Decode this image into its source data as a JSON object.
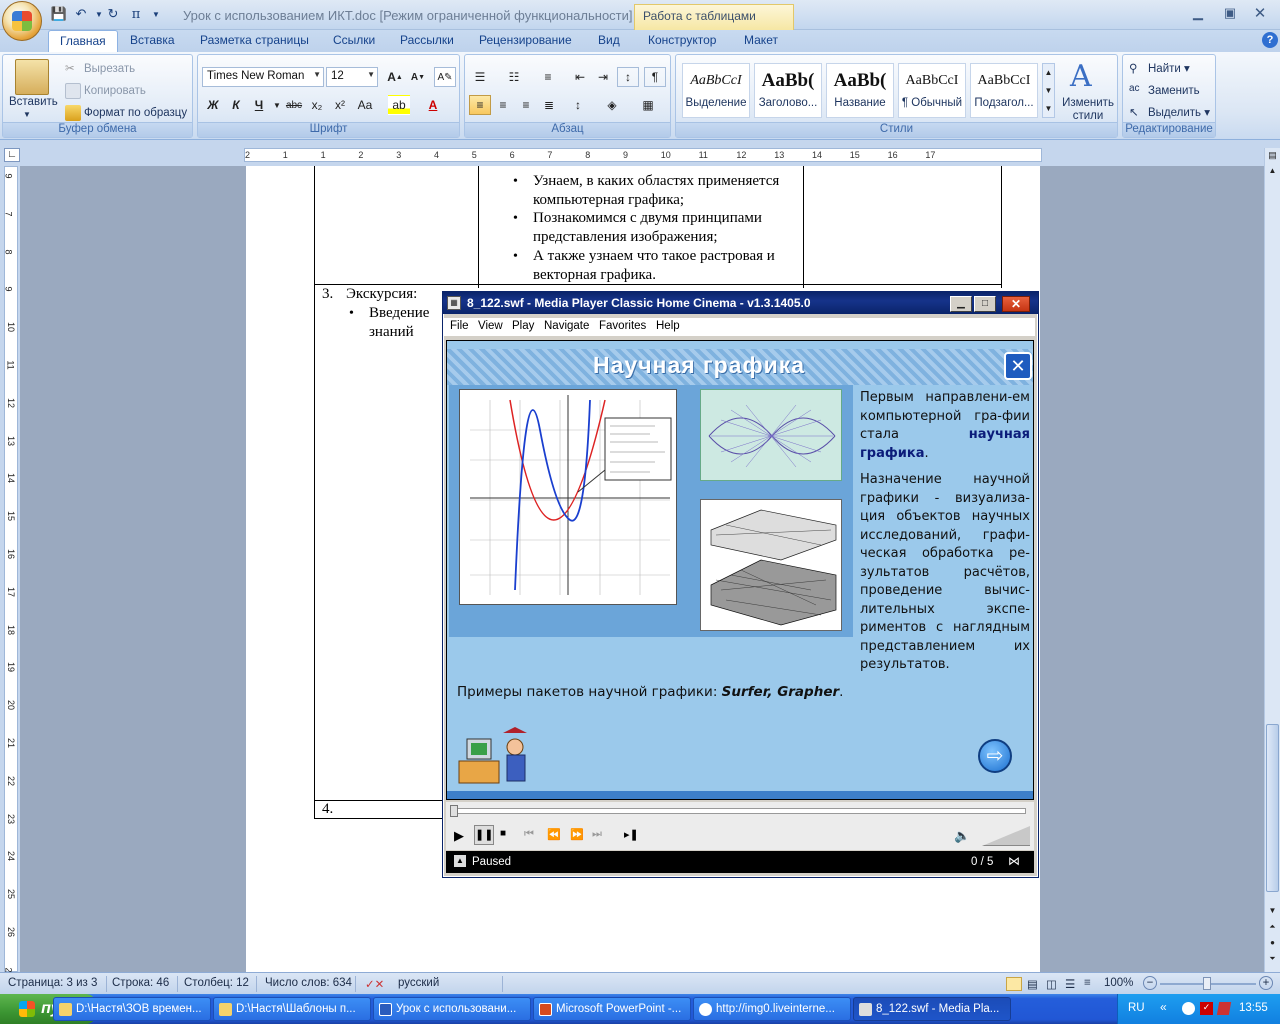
{
  "word": {
    "title": "Урок с использованием ИКТ.doc [Режим ограниченной функциональности] - M",
    "context_tab": "Работа с таблицами",
    "tabs": [
      "Главная",
      "Вставка",
      "Разметка страницы",
      "Ссылки",
      "Рассылки",
      "Рецензирование",
      "Вид",
      "Конструктор",
      "Макет"
    ],
    "clipboard": {
      "paste": "Вставить",
      "cut": "Вырезать",
      "copy": "Копировать",
      "format": "Формат по образцу",
      "label": "Буфер обмена"
    },
    "font": {
      "name": "Times New Roman",
      "size": "12",
      "label": "Шрифт",
      "bold": "Ж",
      "italic": "К",
      "underline": "Ч",
      "strike": "abc",
      "sub": "x₂",
      "sup": "x²",
      "case": "Aa"
    },
    "paragraph": {
      "label": "Абзац"
    },
    "styles": {
      "label": "Стили",
      "items": [
        {
          "sample": "AaBbCcI",
          "name": "Выделение"
        },
        {
          "sample": "AaBb(",
          "name": "Заголово..."
        },
        {
          "sample": "AaBb(",
          "name": "Название"
        },
        {
          "sample": "AaBbCcI",
          "name": "¶ Обычный"
        },
        {
          "sample": "AaBbCcI",
          "name": "Подзагол..."
        }
      ],
      "change": "Изменить стили"
    },
    "editing": {
      "label": "Редактирование",
      "find": "Найти",
      "replace": "Заменить",
      "select": "Выделить"
    },
    "ruler_numbers": [
      "2",
      "1",
      "1",
      "2",
      "3",
      "4",
      "5",
      "6",
      "7",
      "8",
      "9",
      "10",
      "11",
      "12",
      "13",
      "14",
      "15",
      "16",
      "17"
    ],
    "vruler_numbers": [
      "9",
      "7",
      "8",
      "9",
      "10",
      "11",
      "12",
      "13",
      "14",
      "15",
      "16",
      "17",
      "18",
      "19",
      "20",
      "21",
      "22",
      "23",
      "24",
      "25",
      "26",
      "2"
    ],
    "doc": {
      "bullets": [
        "Узнаем, в каких областях применяется компьютерная графика;",
        "Познакомимся с двумя принципами представления изображения;",
        "А также узнаем что такое растровая и векторная графика."
      ],
      "row3_num": "3.",
      "row3_title": "Экскурсия:",
      "row3_bullet": "Введение знаний",
      "row4_num": "4."
    },
    "status": {
      "page": "Страница: 3 из 3",
      "line": "Строка: 46",
      "col": "Столбец: 12",
      "words": "Число слов: 634",
      "lang": "русский",
      "zoom": "100%"
    }
  },
  "mpc": {
    "title": "8_122.swf - Media Player Classic Home Cinema - v1.3.1405.0",
    "menu": [
      "File",
      "View",
      "Play",
      "Navigate",
      "Favorites",
      "Help"
    ],
    "status": "Paused",
    "counter": "0 / 5",
    "slide": {
      "heading": "Научная графика",
      "p1_pre": "Первым направлени-ем компьютерной гра-фии стала ",
      "p1_bold": "научная графика",
      "p1_post": ".",
      "p2": "Назначение научной графики - визуализа-ция объектов научных исследований, графи-ческая обработка ре-зультатов расчётов, проведение вычис-лительных экспе-риментов с наглядным представлением их результатов.",
      "examples_pre": "Примеры пакетов научной графики: ",
      "examples_bold": "Surfer, Grapher",
      "examples_post": "."
    }
  },
  "taskbar": {
    "start": "пуск",
    "items": [
      "D:\\Настя\\ЗОВ времен...",
      "D:\\Настя\\Шаблоны п...",
      "Урок с использовани...",
      "Microsoft PowerPoint -...",
      "http://img0.liveinterne...",
      "8_122.swf - Media Pla..."
    ],
    "lang": "RU",
    "clock": "13:55"
  }
}
